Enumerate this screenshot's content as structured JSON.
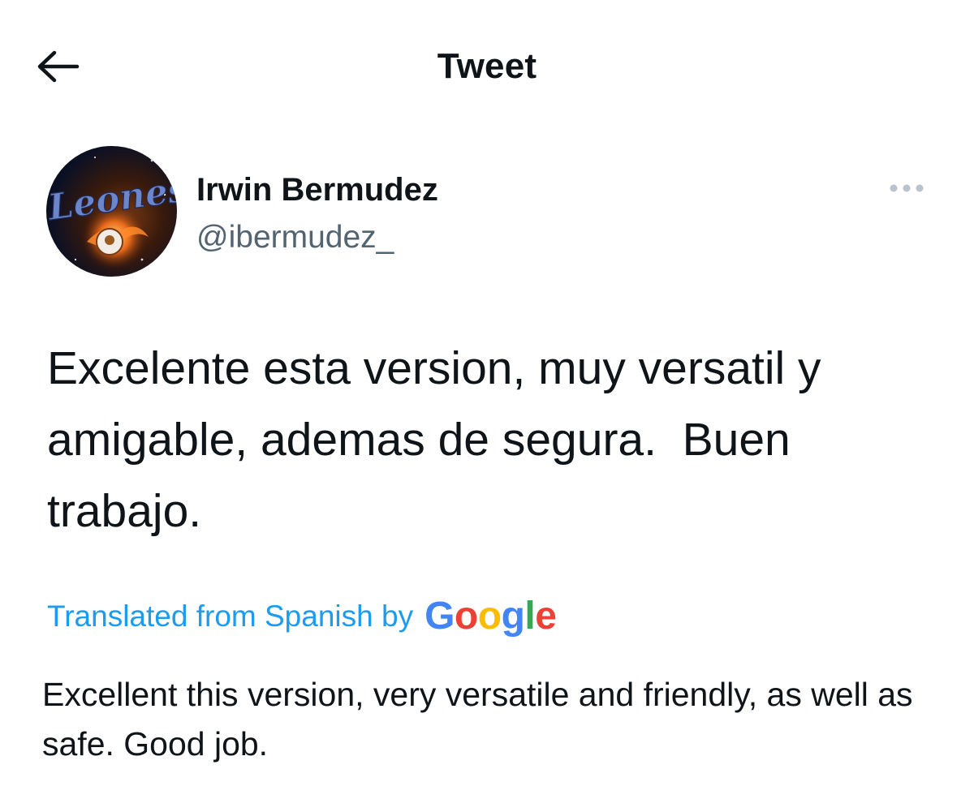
{
  "header": {
    "title": "Tweet",
    "back_icon": "arrow-left-icon"
  },
  "author": {
    "name": "Irwin Bermudez",
    "handle": "@ibermudez_",
    "avatar_text": "Leones"
  },
  "tweet": {
    "text": "Excelente esta version, muy versatil y\namigable, ademas de segura.  Buen\ntrabajo."
  },
  "translation": {
    "label": "Translated from Spanish by",
    "provider": "Google",
    "provider_colors": [
      "#4285F4",
      "#EA4335",
      "#FBBC05",
      "#4285F4",
      "#34A853",
      "#EA4335"
    ],
    "text": "Excellent this version, very versatile and friendly, as well as safe. Good job."
  },
  "colors": {
    "link": "#1d9bf0",
    "secondary_text": "#536471",
    "primary_text": "#0f1419",
    "more_dots": "#b9c3cd"
  }
}
